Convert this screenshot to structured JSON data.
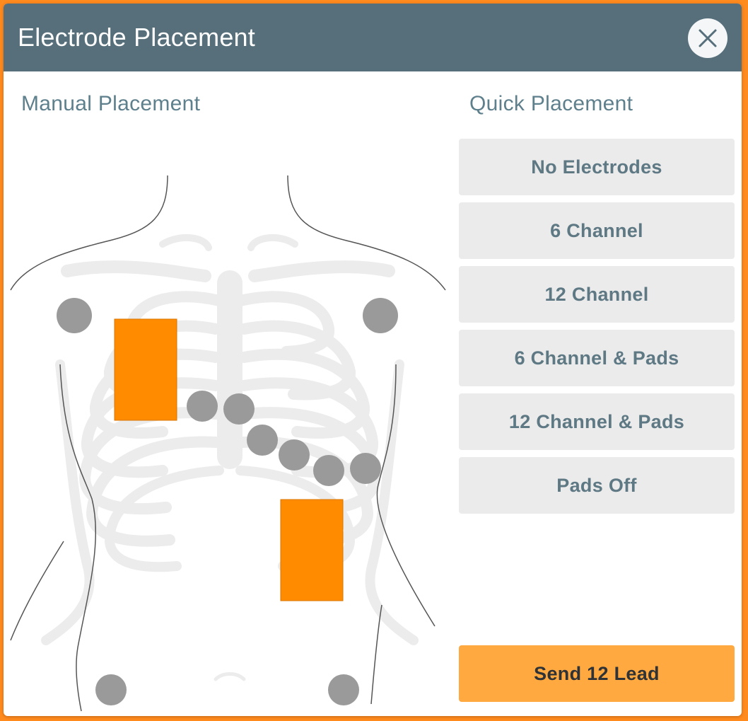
{
  "dialog": {
    "title": "Electrode Placement",
    "close_icon": "close-icon"
  },
  "manual": {
    "title": "Manual Placement"
  },
  "quick": {
    "title": "Quick Placement",
    "buttons": [
      "No Electrodes",
      "6 Channel",
      "12 Channel",
      "6 Channel & Pads",
      "12 Channel & Pads",
      "Pads Off"
    ]
  },
  "send_button": "Send 12 Lead",
  "colors": {
    "frame": "#ff8a1e",
    "header": "#566f7b",
    "section_title": "#5e7f8c",
    "button_bg": "#ebebeb",
    "button_text": "#5e7984",
    "send_bg": "#ffa940",
    "electrode": "#9a9a9a",
    "pad": "#ff8c00"
  }
}
